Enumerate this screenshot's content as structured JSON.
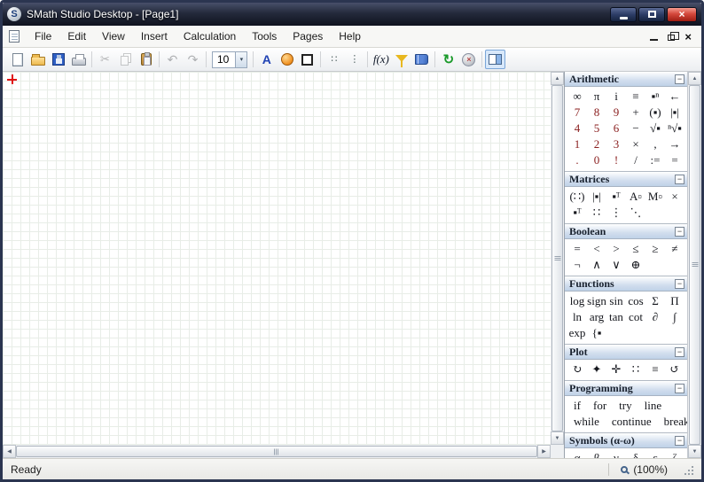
{
  "window": {
    "title": "SMath Studio Desktop - [Page1]",
    "logo": "S"
  },
  "menubar": {
    "items": [
      "File",
      "Edit",
      "View",
      "Insert",
      "Calculation",
      "Tools",
      "Pages",
      "Help"
    ]
  },
  "toolbar": {
    "font_size": "10",
    "dropdown_arrow": "▾",
    "font_color_label": "A",
    "function_label": "f(x)",
    "cut_glyph": "✂",
    "undo_glyph": "↶",
    "redo_glyph": "↷",
    "align_h_glyph": "∷",
    "align_v_glyph": "⋮",
    "recalculate_glyph": "↻",
    "stop_glyph": "×"
  },
  "icons": {
    "up_arrow": "▲",
    "down_arrow": "▼",
    "left_arrow": "◀",
    "right_arrow": "▶",
    "close": "×"
  },
  "sidebar": {
    "collapse_glyph": "−",
    "panels": [
      {
        "title": "Arithmetic",
        "rows": [
          [
            "∞",
            "π",
            "i",
            "≡",
            "▪ⁿ",
            "←"
          ],
          [
            "7",
            "8",
            "9",
            "+",
            "(▪)",
            "|▪|"
          ],
          [
            "4",
            "5",
            "6",
            "−",
            "√▪",
            "ⁿ√▪"
          ],
          [
            "1",
            "2",
            "3",
            "×",
            ",",
            "→"
          ],
          [
            ".",
            "0",
            "!",
            "/",
            ":=",
            "="
          ]
        ]
      },
      {
        "title": "Matrices",
        "rows": [
          [
            "(∷)",
            "|▪|",
            "▪ᵀ",
            "A▫",
            "M▫",
            "×"
          ],
          [
            "▪ᵀ",
            "∷",
            "⋮",
            "⋱"
          ]
        ]
      },
      {
        "title": "Boolean",
        "rows": [
          [
            "=",
            "<",
            ">",
            "≤",
            "≥",
            "≠"
          ],
          [
            "¬",
            "∧",
            "∨",
            "⊕"
          ]
        ]
      },
      {
        "title": "Functions",
        "rows": [
          [
            "log",
            "sign",
            "sin",
            "cos",
            "Σ",
            "Π"
          ],
          [
            "ln",
            "arg",
            "tan",
            "cot",
            "∂",
            "∫"
          ],
          [
            "exp",
            "{▪"
          ]
        ]
      },
      {
        "title": "Plot",
        "rows": [
          [
            "↻",
            "✦",
            "✛",
            "∷",
            "≡",
            "↺"
          ]
        ]
      },
      {
        "title": "Programming",
        "rows": [
          [
            "if",
            "for",
            "try",
            "line"
          ],
          [
            "while",
            "continue",
            "break"
          ]
        ]
      },
      {
        "title": "Symbols (α-ω)",
        "rows": [
          [
            "α",
            "β",
            "γ",
            "δ",
            "ε",
            "ζ"
          ]
        ]
      }
    ]
  },
  "statusbar": {
    "status": "Ready",
    "zoom": "(100%)"
  }
}
